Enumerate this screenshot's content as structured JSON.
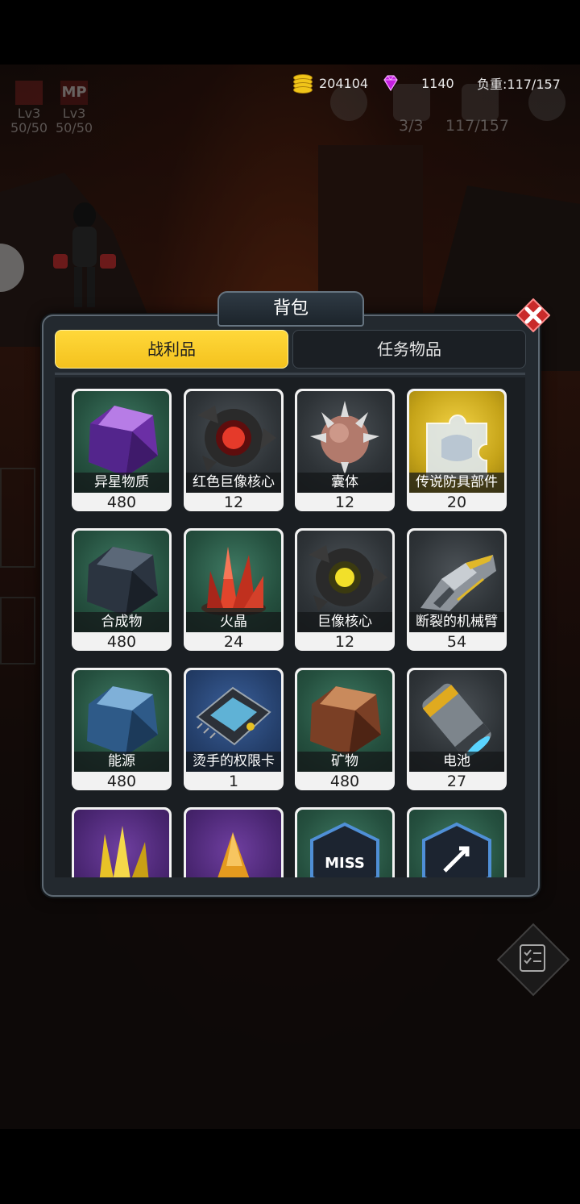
{
  "hud": {
    "gold": "204104",
    "gems": "1140",
    "load": "负重:117/157",
    "dim_counter_1": "3/3",
    "dim_counter_2": "117/157",
    "party": [
      {
        "level": "Lv3",
        "hp": "50/50",
        "tag": ""
      },
      {
        "level": "Lv3",
        "hp": "50/50",
        "tag": "MP"
      }
    ]
  },
  "panel": {
    "title": "背包",
    "tabs": [
      {
        "label": "战利品",
        "active": true
      },
      {
        "label": "任务物品",
        "active": false
      }
    ]
  },
  "items": [
    {
      "name": "异星物质",
      "qty": "480",
      "icon": "purple-crystal-icon"
    },
    {
      "name": "红色巨像核心",
      "qty": "12",
      "icon": "red-core-icon"
    },
    {
      "name": "囊体",
      "qty": "12",
      "icon": "spiked-sac-icon"
    },
    {
      "name": "传说防具部件",
      "qty": "20",
      "icon": "armor-puzzle-icon"
    },
    {
      "name": "合成物",
      "qty": "480",
      "icon": "dark-crystal-icon"
    },
    {
      "name": "火晶",
      "qty": "24",
      "icon": "fire-crystal-icon"
    },
    {
      "name": "巨像核心",
      "qty": "12",
      "icon": "yellow-core-icon"
    },
    {
      "name": "断裂的机械臂",
      "qty": "54",
      "icon": "mech-arm-icon"
    },
    {
      "name": "能源",
      "qty": "480",
      "icon": "blue-crystal-icon"
    },
    {
      "name": "烫手的权限卡",
      "qty": "1",
      "icon": "chip-card-icon"
    },
    {
      "name": "矿物",
      "qty": "480",
      "icon": "ore-crystal-icon"
    },
    {
      "name": "电池",
      "qty": "27",
      "icon": "battery-icon"
    },
    {
      "name": "",
      "qty": "",
      "icon": "gold-crystal-icon"
    },
    {
      "name": "",
      "qty": "",
      "icon": "amber-crystal-icon"
    },
    {
      "name": "",
      "qty": "",
      "icon": "miss-chip-icon",
      "art_text": "MISS"
    },
    {
      "name": "",
      "qty": "",
      "icon": "arrow-chip-icon"
    }
  ],
  "colors": {
    "tab_active": "#f4c21e",
    "panel_bg": "#23292f",
    "close_red": "#c92a2a"
  }
}
